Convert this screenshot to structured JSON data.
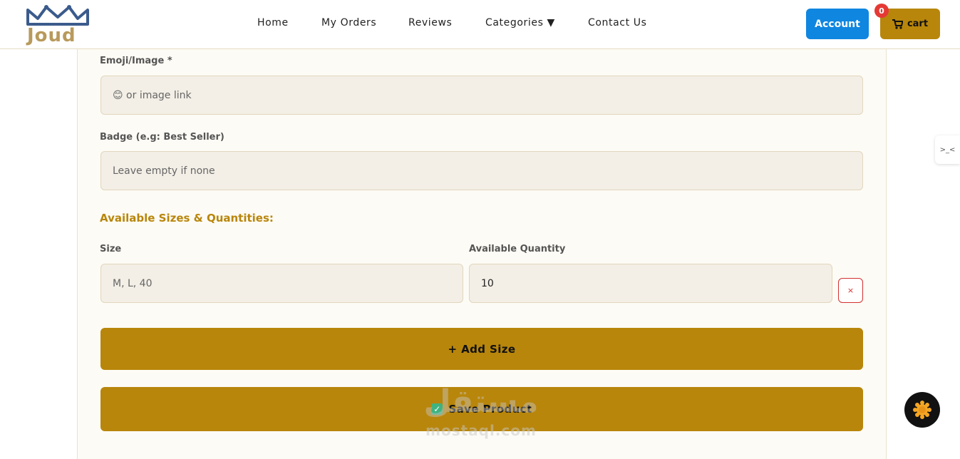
{
  "header": {
    "logo_text": "Joud",
    "nav": [
      {
        "label": "Home"
      },
      {
        "label": "My Orders"
      },
      {
        "label": "Reviews"
      },
      {
        "label": "Categories ▼"
      },
      {
        "label": "Contact Us"
      }
    ],
    "account_label": "Account",
    "cart_label": "cart",
    "cart_count": "0"
  },
  "form": {
    "emoji_label": "Emoji/Image *",
    "emoji_placeholder": "😊 or image link",
    "badge_label": "Badge (e.g: Best Seller)",
    "badge_placeholder": "Leave empty if none",
    "sizes_title": "Available Sizes & Quantities:",
    "size_label": "Size",
    "size_placeholder": "M, L, 40",
    "quantity_label": "Available Quantity",
    "quantity_value": "10",
    "remove_label": "×",
    "add_size_label": "+ Add Size",
    "save_label": "Save Product"
  },
  "watermark": {
    "arabic": "مستقل",
    "latin": "mostaql.com"
  },
  "side_tab_label": ">_<",
  "colors": {
    "accent": "#b8860b",
    "primary_blue": "#0f86e0",
    "badge_red": "#e53935",
    "field_bg": "#f3efe6"
  }
}
